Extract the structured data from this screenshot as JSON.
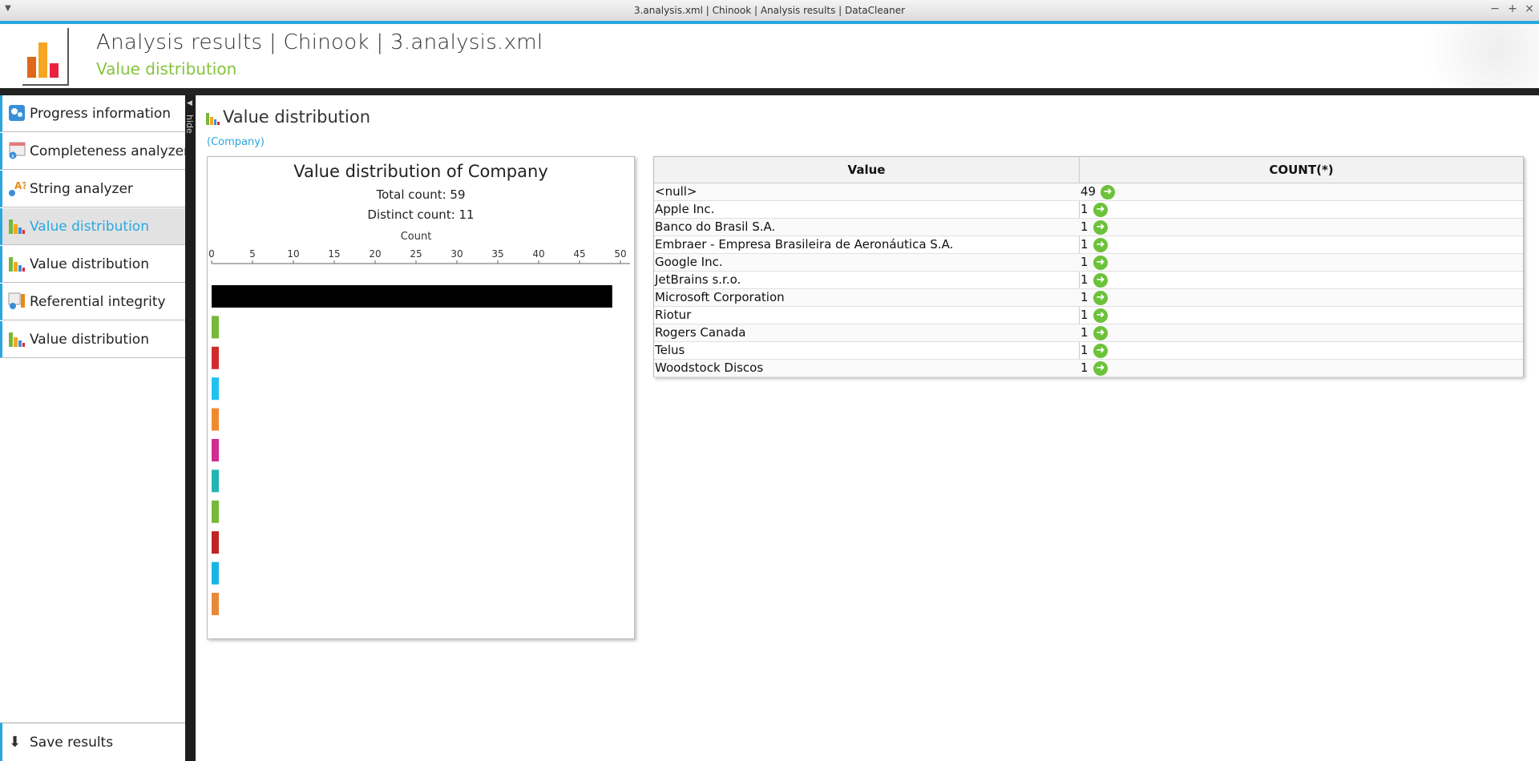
{
  "window": {
    "title": "3.analysis.xml | Chinook | Analysis results | DataCleaner",
    "minimize": "−",
    "maximize": "+",
    "close": "×"
  },
  "header": {
    "title": "Analysis results  |  Chinook  |  3.analysis.xml",
    "subtitle": "Value distribution"
  },
  "sidebar": {
    "hide_label": "hide",
    "items": [
      {
        "label": "Progress information",
        "icon": "progress-icon"
      },
      {
        "label": "Completeness analyzer",
        "icon": "completeness-icon"
      },
      {
        "label": "String analyzer",
        "icon": "string-analyzer-icon"
      },
      {
        "label": "Value distribution",
        "icon": "value-distribution-icon",
        "selected": true
      },
      {
        "label": "Value distribution",
        "icon": "value-distribution-icon"
      },
      {
        "label": "Referential integrity",
        "icon": "referential-integrity-icon"
      },
      {
        "label": "Value distribution",
        "icon": "value-distribution-icon"
      }
    ],
    "save_label": "Save results"
  },
  "section": {
    "title": "Value distribution",
    "column": "(Company)"
  },
  "chart_data": {
    "type": "bar",
    "title": "Value distribution of Company",
    "total_count_label": "Total count: 59",
    "distinct_count_label": "Distinct count: 11",
    "xlabel": "Count",
    "xlim": [
      0,
      50
    ],
    "ticks": [
      0,
      5,
      10,
      15,
      20,
      25,
      30,
      35,
      40,
      45,
      50
    ],
    "categories": [
      "<null>",
      "Apple Inc.",
      "Banco do Brasil S.A.",
      "Embraer - Empresa Brasileira de Aeronáutica S.A.",
      "Google Inc.",
      "JetBrains s.r.o.",
      "Microsoft Corporation",
      "Riotur",
      "Rogers Canada",
      "Telus",
      "Woodstock Discos"
    ],
    "values": [
      49,
      1,
      1,
      1,
      1,
      1,
      1,
      1,
      1,
      1,
      1
    ],
    "colors": [
      "#000000",
      "#78b83a",
      "#d02c2c",
      "#22c2f0",
      "#f08a2e",
      "#d02c92",
      "#24b4b4",
      "#78b83a",
      "#c02424",
      "#1ab4e4",
      "#e88a3a"
    ]
  },
  "table": {
    "headers": [
      "Value",
      "COUNT(*)"
    ],
    "rows": [
      {
        "value": "<null>",
        "count": "49"
      },
      {
        "value": "Apple Inc.",
        "count": "1"
      },
      {
        "value": "Banco do Brasil S.A.",
        "count": "1"
      },
      {
        "value": "Embraer - Empresa Brasileira de Aeronáutica S.A.",
        "count": "1"
      },
      {
        "value": "Google Inc.",
        "count": "1"
      },
      {
        "value": "JetBrains s.r.o.",
        "count": "1"
      },
      {
        "value": "Microsoft Corporation",
        "count": "1"
      },
      {
        "value": "Riotur",
        "count": "1"
      },
      {
        "value": "Rogers Canada",
        "count": "1"
      },
      {
        "value": "Telus",
        "count": "1"
      },
      {
        "value": "Woodstock Discos",
        "count": "1"
      }
    ]
  }
}
